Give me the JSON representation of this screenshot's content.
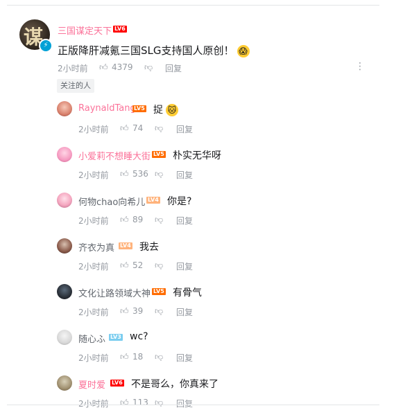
{
  "root": {
    "username": "三国谋定天下",
    "level": "LV6",
    "content": "正版降肝减氪三国SLG支持国人原创！",
    "time": "2小时前",
    "likes": "4379",
    "reply_label": "回复",
    "tag": "关注的人",
    "name_color": "#fb7299"
  },
  "replies": [
    {
      "username": "RaynaldTang",
      "level": "LV5",
      "content": "捉",
      "time": "2小时前",
      "likes": "74",
      "reply_label": "回复",
      "name_color": "#fb7299"
    },
    {
      "username": "小爱莉不想睡大街",
      "level": "LV5",
      "content": "朴实无华呀",
      "time": "2小时前",
      "likes": "536",
      "reply_label": "回复",
      "name_color": "#fb7299"
    },
    {
      "username": "何物chao向希儿",
      "level": "LV4",
      "content": "你是?",
      "time": "2小时前",
      "likes": "89",
      "reply_label": "回复",
      "name_color": "#61666d"
    },
    {
      "username": "齐衣为真",
      "level": "LV4",
      "content": "我去",
      "time": "2小时前",
      "likes": "52",
      "reply_label": "回复",
      "name_color": "#61666d"
    },
    {
      "username": "文化让路领域大神",
      "level": "LV5",
      "content": "有骨气",
      "time": "2小时前",
      "likes": "39",
      "reply_label": "回复",
      "name_color": "#61666d"
    },
    {
      "username": "随心ふ",
      "level": "LV3",
      "content": "wc?",
      "time": "2小时前",
      "likes": "18",
      "reply_label": "回复",
      "name_color": "#61666d"
    },
    {
      "username": "夏时爱",
      "level": "LV6",
      "content": "不是哥么，你真来了",
      "time": "2小时前",
      "likes": "113",
      "reply_label": "回复",
      "name_color": "#fb7299"
    }
  ]
}
